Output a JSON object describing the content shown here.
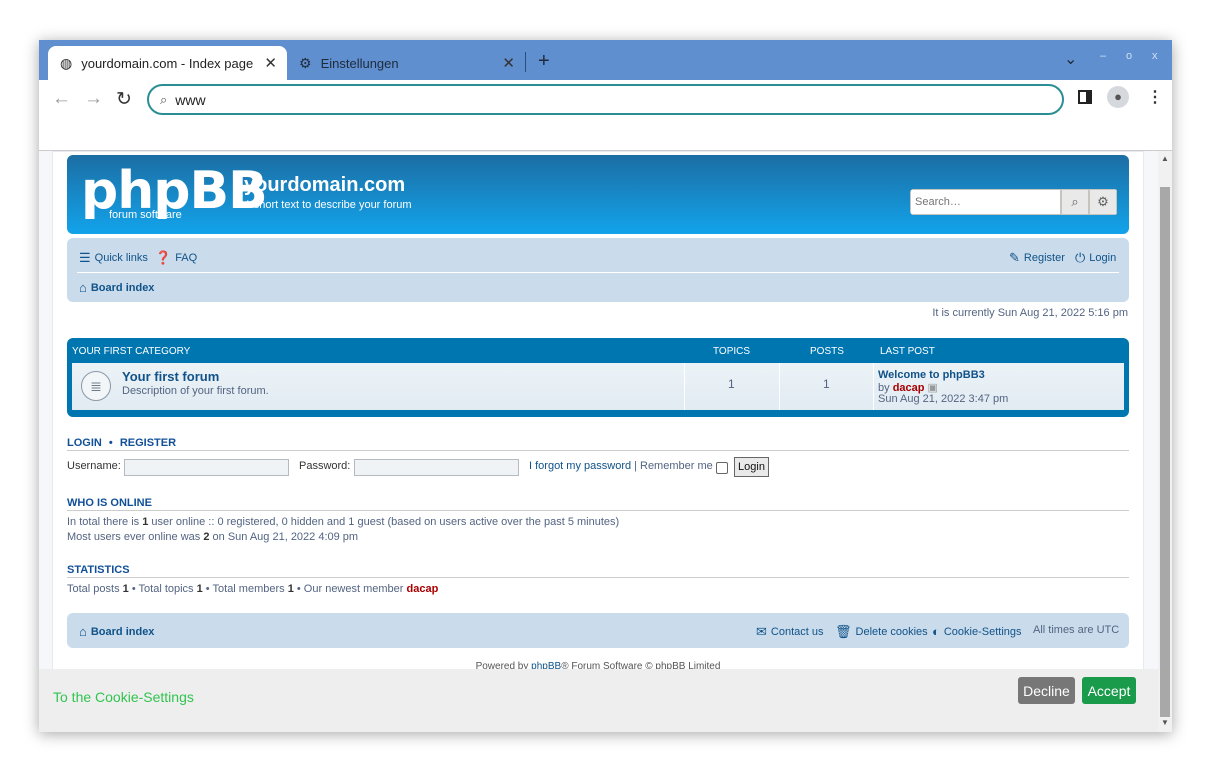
{
  "browser": {
    "tabs": [
      {
        "label": "yourdomain.com - Index page",
        "close": "✕"
      },
      {
        "label": "Einstellungen",
        "close": "✕"
      }
    ],
    "new_tab": "+",
    "window_controls": {
      "dropdown": "⌄",
      "minimize": "–",
      "maximize": "o",
      "close": "x"
    },
    "address": "www"
  },
  "header": {
    "logo": "phpBB",
    "logo_sub": "forum  software",
    "site_title": "yourdomain.com",
    "site_desc": "A short text to describe your forum",
    "search_placeholder": "Search…"
  },
  "navbar": {
    "quick_links": "Quick links",
    "faq": "FAQ",
    "register": "Register",
    "login": "Login",
    "board_index": "Board index"
  },
  "current_time": "It is currently Sun Aug 21, 2022 5:16 pm",
  "forum": {
    "category": "YOUR FIRST CATEGORY",
    "col_topics": "TOPICS",
    "col_posts": "POSTS",
    "col_last_post": "LAST POST",
    "row": {
      "title": "Your first forum",
      "description": "Description of your first forum.",
      "topics": "1",
      "posts": "1",
      "last_post_title": "Welcome to phpBB3",
      "last_post_by": "by",
      "last_post_user": "dacap",
      "last_post_date": "Sun Aug 21, 2022 3:47 pm"
    }
  },
  "login_section": {
    "title_login": "LOGIN",
    "dot": "•",
    "title_register": "REGISTER",
    "username_label": "Username:",
    "password_label": "Password:",
    "forgot": "I forgot my password",
    "sep": "|",
    "remember": "Remember me",
    "login_button": "Login"
  },
  "online": {
    "title": "WHO IS ONLINE",
    "line1_a": "In total there is ",
    "line1_b": "1",
    "line1_c": " user online :: 0 registered, 0 hidden and 1 guest (based on users active over the past 5 minutes)",
    "line2_a": "Most users ever online was ",
    "line2_b": "2",
    "line2_c": " on Sun Aug 21, 2022 4:09 pm"
  },
  "stats": {
    "title": "STATISTICS",
    "t1": "Total posts ",
    "n1": "1",
    "t2": " • Total topics ",
    "n2": "1",
    "t3": " • Total members ",
    "n3": "1",
    "t4": " • Our newest member ",
    "member": "dacap"
  },
  "footer": {
    "board_index": "Board index",
    "contact": "Contact us",
    "delete_cookies": "Delete cookies",
    "cookie_settings": "Cookie-Settings",
    "timezone": "All times are UTC",
    "powered_a": "Powered by ",
    "powered_link": "phpBB",
    "powered_b": "® Forum Software © phpBB Limited"
  },
  "cookie_bar": {
    "link": "To the Cookie-Settings",
    "decline": "Decline",
    "accept": "Accept"
  },
  "colors": {
    "tabstrip": "#5f8fcf",
    "header": "#1c6ea3",
    "navbar": "#cadceb",
    "accept": "#1a9a4b",
    "cookie_link": "#31c44f"
  }
}
